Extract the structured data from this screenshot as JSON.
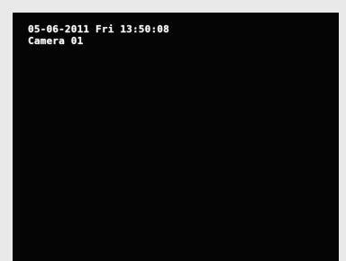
{
  "overlay": {
    "timestamp": "05-06-2011 Fri 13:50:08",
    "camera_name": "Camera 01"
  },
  "colors": {
    "background": "#e9e9e9",
    "video_black": "#050505",
    "osd_text": "#f4f4f4"
  }
}
